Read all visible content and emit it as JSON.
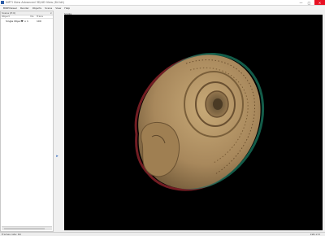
{
  "window": {
    "title": "NIFTI View  Advanced 3D/4D View (64 bit)",
    "minimize": "—",
    "maximize": "□",
    "close": "✕"
  },
  "menu": [
    "BIRPViewer",
    "Render",
    "Objects",
    "Scene",
    "View",
    "Help"
  ],
  "panel": {
    "title": "Scene (P:0)",
    "close": "×",
    "columns": [
      "Object",
      "Vis",
      "Trans"
    ],
    "objects": [
      {
        "name": "Single Object",
        "icon": "heart-icon",
        "vis": "1",
        "trans": "100"
      }
    ]
  },
  "viewport": {
    "label": "Single"
  },
  "status": {
    "left": "Frames rate: 60",
    "right": "198,172"
  },
  "colors": {
    "viewport_bg": "#000000",
    "shell_base": "#a8885c"
  }
}
